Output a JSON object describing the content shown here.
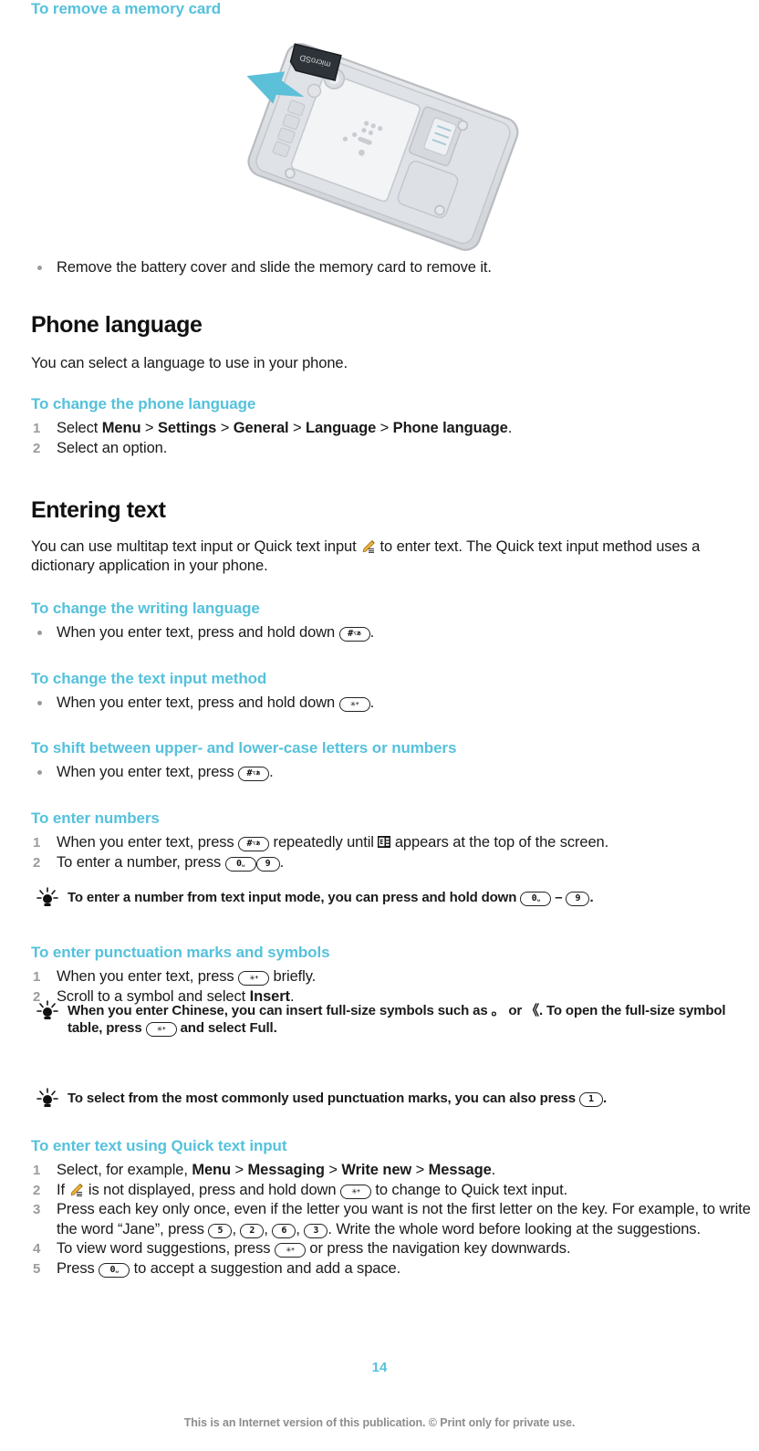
{
  "document": {
    "page_number": "14",
    "disclaimer": "This is an Internet version of this publication. © Print only for private use."
  },
  "colors": {
    "heading_accent": "#55c1dc",
    "body_text": "#1a1a1a",
    "step_number": "#9b9b9b",
    "footer_text": "#8d8d8d",
    "arrow": "#5cc0d8",
    "pencil": "#f0b23c"
  },
  "sections": [
    {
      "id": "remove-memory-card",
      "type": "procedure",
      "heading": "To remove a memory card",
      "figure": {
        "alt": "Back of phone with battery cover removed and microSD memory card sliding out",
        "card_label": "microSD"
      },
      "bullets": [
        "Remove the battery cover and slide the memory card to remove it."
      ]
    },
    {
      "id": "phone-language",
      "type": "section",
      "heading": "Phone language",
      "intro": "You can select a language to use in your phone.",
      "procedures": [
        {
          "heading": "To change the phone language",
          "steps": [
            {
              "parts": [
                {
                  "t": "text",
                  "v": "Select "
                },
                {
                  "t": "bold",
                  "v": "Menu"
                },
                {
                  "t": "sep",
                  "v": " > "
                },
                {
                  "t": "bold",
                  "v": "Settings"
                },
                {
                  "t": "sep",
                  "v": " > "
                },
                {
                  "t": "bold",
                  "v": "General"
                },
                {
                  "t": "sep",
                  "v": " > "
                },
                {
                  "t": "bold",
                  "v": "Language"
                },
                {
                  "t": "sep",
                  "v": " > "
                },
                {
                  "t": "bold",
                  "v": "Phone language"
                },
                {
                  "t": "text",
                  "v": "."
                }
              ]
            },
            {
              "parts": [
                {
                  "t": "text",
                  "v": "Select an option."
                }
              ]
            }
          ]
        }
      ]
    },
    {
      "id": "entering-text",
      "type": "section",
      "heading": "Entering text",
      "intro_parts": [
        {
          "t": "text",
          "v": "You can use multitap text input or Quick text input "
        },
        {
          "t": "icon",
          "v": "pencil-icon"
        },
        {
          "t": "text",
          "v": " to enter text. The Quick text input method uses a dictionary application in your phone."
        }
      ]
    },
    {
      "id": "change-writing-language",
      "type": "procedure",
      "heading": "To change the writing language",
      "bullet_parts": [
        [
          {
            "t": "text",
            "v": "When you enter text, press and hold down "
          },
          {
            "t": "key",
            "v": "hash-key"
          },
          {
            "t": "text",
            "v": "."
          }
        ]
      ]
    },
    {
      "id": "change-text-input-method",
      "type": "procedure",
      "heading": "To change the text input method",
      "bullet_parts": [
        [
          {
            "t": "text",
            "v": "When you enter text, press and hold down "
          },
          {
            "t": "key",
            "v": "star-key"
          },
          {
            "t": "text",
            "v": "."
          }
        ]
      ]
    },
    {
      "id": "shift-case",
      "type": "procedure",
      "heading": "To shift between upper- and lower-case letters or numbers",
      "bullet_parts": [
        [
          {
            "t": "text",
            "v": "When you enter text, press "
          },
          {
            "t": "key",
            "v": "hash-key"
          },
          {
            "t": "text",
            "v": "."
          }
        ]
      ]
    },
    {
      "id": "enter-numbers",
      "type": "procedure",
      "heading": "To enter numbers",
      "steps_parts": [
        [
          {
            "t": "text",
            "v": "When you enter text, press "
          },
          {
            "t": "key",
            "v": "hash-key"
          },
          {
            "t": "text",
            "v": " repeatedly until "
          },
          {
            "t": "icon",
            "v": "numeric-mode-icon"
          },
          {
            "t": "text",
            "v": " appears at the top of the screen."
          }
        ],
        [
          {
            "t": "text",
            "v": "To enter a number, press "
          },
          {
            "t": "key",
            "v": "zero-key"
          },
          {
            "t": "key",
            "v": "nine-key"
          },
          {
            "t": "text",
            "v": "."
          }
        ]
      ],
      "tip_parts": [
        {
          "t": "text",
          "v": "To enter a number from text input mode, you can press and hold down "
        },
        {
          "t": "key",
          "v": "zero-key"
        },
        {
          "t": "text",
          "v": " – "
        },
        {
          "t": "key",
          "v": "nine-key"
        },
        {
          "t": "text",
          "v": "."
        }
      ]
    },
    {
      "id": "enter-punctuation",
      "type": "procedure",
      "heading": "To enter punctuation marks and symbols",
      "steps_parts": [
        [
          {
            "t": "text",
            "v": "When you enter text, press "
          },
          {
            "t": "key",
            "v": "star-key"
          },
          {
            "t": "text",
            "v": " briefly."
          }
        ],
        [
          {
            "t": "text",
            "v": "Scroll to a symbol and select "
          },
          {
            "t": "bold",
            "v": "Insert"
          },
          {
            "t": "text",
            "v": "."
          }
        ]
      ],
      "tips_parts": [
        [
          {
            "t": "text",
            "v": "When you enter Chinese, you can insert full-size symbols such as 。 or 《. To open the full-size symbol table, press "
          },
          {
            "t": "key",
            "v": "star-key"
          },
          {
            "t": "text",
            "v": " and select "
          },
          {
            "t": "bold",
            "v": "Full"
          },
          {
            "t": "text",
            "v": "."
          }
        ],
        [
          {
            "t": "text",
            "v": "To select from the most commonly used punctuation marks, you can also press "
          },
          {
            "t": "key",
            "v": "one-key"
          },
          {
            "t": "text",
            "v": "."
          }
        ]
      ]
    },
    {
      "id": "quick-text-input",
      "type": "procedure",
      "heading": "To enter text using Quick text input",
      "steps_parts": [
        [
          {
            "t": "text",
            "v": "Select, for example, "
          },
          {
            "t": "bold",
            "v": "Menu"
          },
          {
            "t": "sep",
            "v": " > "
          },
          {
            "t": "bold",
            "v": "Messaging"
          },
          {
            "t": "sep",
            "v": " > "
          },
          {
            "t": "bold",
            "v": "Write new"
          },
          {
            "t": "sep",
            "v": " > "
          },
          {
            "t": "bold",
            "v": "Message"
          },
          {
            "t": "text",
            "v": "."
          }
        ],
        [
          {
            "t": "text",
            "v": "If "
          },
          {
            "t": "icon",
            "v": "pencil-icon"
          },
          {
            "t": "text",
            "v": " is not displayed, press and hold down "
          },
          {
            "t": "key",
            "v": "star-key"
          },
          {
            "t": "text",
            "v": " to change to Quick text input."
          }
        ],
        [
          {
            "t": "text",
            "v": "Press each key only once, even if the letter you want is not the first letter on the key. For example, to write the word “Jane”, press "
          },
          {
            "t": "key",
            "v": "five-key"
          },
          {
            "t": "text",
            "v": ", "
          },
          {
            "t": "key",
            "v": "two-key"
          },
          {
            "t": "text",
            "v": ", "
          },
          {
            "t": "key",
            "v": "six-key"
          },
          {
            "t": "text",
            "v": ", "
          },
          {
            "t": "key",
            "v": "three-key"
          },
          {
            "t": "text",
            "v": ". Write the whole word before looking at the suggestions."
          }
        ],
        [
          {
            "t": "text",
            "v": "To view word suggestions, press "
          },
          {
            "t": "key",
            "v": "star-key"
          },
          {
            "t": "text",
            "v": " or press the navigation key downwards."
          }
        ],
        [
          {
            "t": "text",
            "v": "Press "
          },
          {
            "t": "key",
            "v": "zero-key"
          },
          {
            "t": "text",
            "v": " to accept a suggestion and add a space."
          }
        ]
      ]
    }
  ],
  "keys": {
    "hash-key": {
      "main": "#",
      "sub": "⌥ぁ"
    },
    "star-key": {
      "main": "✳",
      "sub": "+"
    },
    "zero-key": {
      "main": "0",
      "sub": "␣"
    },
    "one-key": {
      "main": "1",
      "sub": ""
    },
    "two-key": {
      "main": "2",
      "sub": ""
    },
    "three-key": {
      "main": "3",
      "sub": ""
    },
    "five-key": {
      "main": "5",
      "sub": ""
    },
    "six-key": {
      "main": "6",
      "sub": ""
    },
    "nine-key": {
      "main": "9",
      "sub": ""
    }
  }
}
